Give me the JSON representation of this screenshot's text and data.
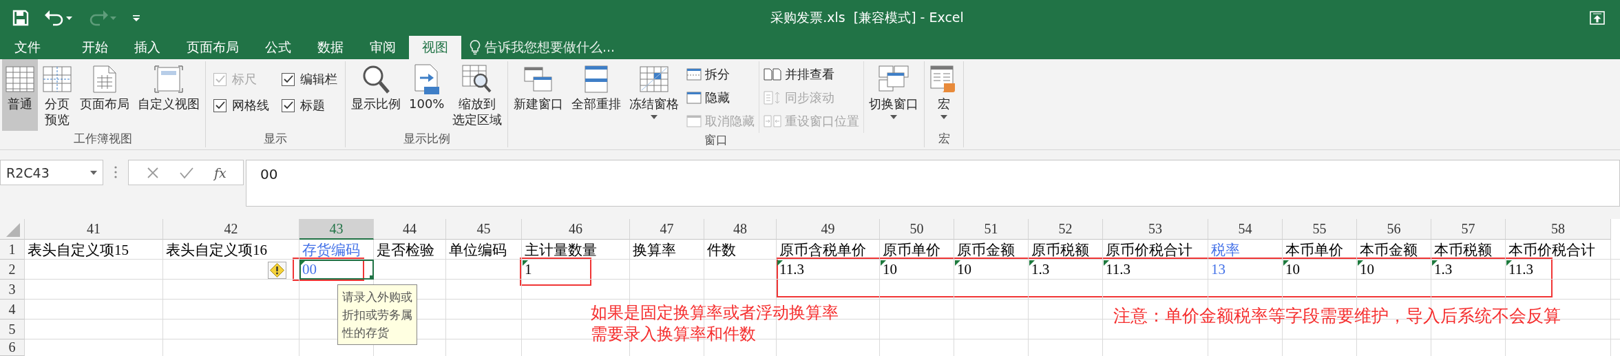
{
  "title_bar": {
    "title": "采购发票.xls  [兼容模式] - Excel",
    "quick_access": [
      {
        "kind": "save",
        "disabled": false
      },
      {
        "kind": "undo",
        "disabled": false
      },
      {
        "kind": "redo",
        "disabled": true
      },
      {
        "kind": "customize",
        "disabled": false
      }
    ]
  },
  "tabs": [
    {
      "label": "文件",
      "selected": false
    },
    {
      "label": "开始",
      "selected": false
    },
    {
      "label": "插入",
      "selected": false
    },
    {
      "label": "页面布局",
      "selected": false
    },
    {
      "label": "公式",
      "selected": false
    },
    {
      "label": "数据",
      "selected": false
    },
    {
      "label": "审阅",
      "selected": false
    },
    {
      "label": "视图",
      "selected": true
    }
  ],
  "tell_me": {
    "placeholder": "告诉我您想要做什么..."
  },
  "ribbon": {
    "groups": [
      {
        "label": "工作簿视图",
        "items": [
          {
            "kind": "large",
            "label": "普通",
            "selected": true
          },
          {
            "kind": "large",
            "label": "分页预览",
            "selected": false
          },
          {
            "kind": "large",
            "label": "页面布局",
            "selected": false
          },
          {
            "kind": "large",
            "label": "自定义视图",
            "selected": false
          }
        ]
      },
      {
        "label": "显示",
        "items": [
          {
            "kind": "check",
            "label": "标尺",
            "checked": true,
            "disabled": true
          },
          {
            "kind": "check",
            "label": "编辑栏",
            "checked": true,
            "disabled": false
          },
          {
            "kind": "check",
            "label": "网格线",
            "checked": true,
            "disabled": false
          },
          {
            "kind": "check",
            "label": "标题",
            "checked": true,
            "disabled": false
          }
        ]
      },
      {
        "label": "显示比例",
        "items": [
          {
            "kind": "large",
            "label": "显示比例"
          },
          {
            "kind": "large",
            "label": "100%"
          },
          {
            "kind": "large",
            "label": "缩放到选定区域"
          }
        ]
      },
      {
        "label": "窗口",
        "items": [
          {
            "kind": "large",
            "label": "新建窗口"
          },
          {
            "kind": "large",
            "label": "全部重排"
          },
          {
            "kind": "large",
            "label": "冻结窗格",
            "dropdown": true
          },
          {
            "kind": "small",
            "label": "拆分",
            "disabled": false
          },
          {
            "kind": "small",
            "label": "隐藏",
            "disabled": false
          },
          {
            "kind": "small",
            "label": "取消隐藏",
            "disabled": true
          },
          {
            "kind": "small",
            "label": "并排查看",
            "disabled": false
          },
          {
            "kind": "small",
            "label": "同步滚动",
            "disabled": true
          },
          {
            "kind": "small",
            "label": "重设窗口位置",
            "disabled": true
          },
          {
            "kind": "large",
            "label": "切换窗口",
            "dropdown": true
          }
        ]
      },
      {
        "label": "宏",
        "items": [
          {
            "kind": "large",
            "label": "宏",
            "dropdown": true
          }
        ]
      }
    ]
  },
  "formula_bar": {
    "name_box": "R2C43",
    "function_button": "fx",
    "formula": "00"
  },
  "sheet": {
    "columns": [
      {
        "label": "41",
        "selected": false
      },
      {
        "label": "42",
        "selected": false
      },
      {
        "label": "43",
        "selected": true
      },
      {
        "label": "44",
        "selected": false
      },
      {
        "label": "45",
        "selected": false
      },
      {
        "label": "46",
        "selected": false
      },
      {
        "label": "47",
        "selected": false
      },
      {
        "label": "48",
        "selected": false
      },
      {
        "label": "49",
        "selected": false
      },
      {
        "label": "50",
        "selected": false
      },
      {
        "label": "51",
        "selected": false
      },
      {
        "label": "52",
        "selected": false
      },
      {
        "label": "53",
        "selected": false
      },
      {
        "label": "54",
        "selected": false
      },
      {
        "label": "55",
        "selected": false
      },
      {
        "label": "56",
        "selected": false
      },
      {
        "label": "57",
        "selected": false
      },
      {
        "label": "58",
        "selected": false
      }
    ],
    "rows": [
      {
        "label": "1",
        "cells": [
          {
            "text": "表头自定义项15",
            "color": "#000000"
          },
          {
            "text": "表头自定义项16",
            "color": "#000000"
          },
          {
            "text": "存货编码",
            "color": "#4472e8"
          },
          {
            "text": "是否检验",
            "color": "#000000"
          },
          {
            "text": "单位编码",
            "color": "#000000"
          },
          {
            "text": "主计量数量",
            "color": "#000000"
          },
          {
            "text": "换算率",
            "color": "#000000"
          },
          {
            "text": "件数",
            "color": "#000000"
          },
          {
            "text": "原币含税单价",
            "color": "#000000"
          },
          {
            "text": "原币单价",
            "color": "#000000"
          },
          {
            "text": "原币金额",
            "color": "#000000"
          },
          {
            "text": "原币税额",
            "color": "#000000"
          },
          {
            "text": "原币价税合计",
            "color": "#000000"
          },
          {
            "text": "税率",
            "color": "#4472e8"
          },
          {
            "text": "本币单价",
            "color": "#000000"
          },
          {
            "text": "本币金额",
            "color": "#000000"
          },
          {
            "text": "本币税额",
            "color": "#000000"
          },
          {
            "text": "本币价税合计",
            "color": "#000000"
          }
        ]
      },
      {
        "label": "2",
        "cells": [
          null,
          null,
          {
            "text": "00",
            "color": "#4472e8",
            "flagged": true,
            "selected": true
          },
          null,
          null,
          {
            "text": "1",
            "color": "#000000",
            "flagged": true,
            "selected": false
          },
          null,
          null,
          {
            "text": "11.3",
            "color": "#000000",
            "flagged": true,
            "selected": false
          },
          {
            "text": "10",
            "color": "#000000",
            "flagged": true,
            "selected": false
          },
          {
            "text": "10",
            "color": "#000000",
            "flagged": true,
            "selected": false
          },
          {
            "text": "1.3",
            "color": "#000000",
            "flagged": true,
            "selected": false
          },
          {
            "text": "11.3",
            "color": "#000000",
            "flagged": true,
            "selected": false
          },
          {
            "text": "13",
            "color": "#4472e8",
            "flagged": false,
            "selected": false
          },
          {
            "text": "10",
            "color": "#000000",
            "flagged": true,
            "selected": false
          },
          {
            "text": "10",
            "color": "#000000",
            "flagged": true,
            "selected": false
          },
          {
            "text": "1.3",
            "color": "#000000",
            "flagged": true,
            "selected": false
          },
          {
            "text": "11.3",
            "color": "#000000",
            "flagged": true,
            "selected": false
          }
        ]
      },
      {
        "label": "3"
      },
      {
        "label": "4"
      },
      {
        "label": "5"
      },
      {
        "label": "6"
      }
    ],
    "tooltip": "请录入外购或折扣或劳务属性的存货",
    "notes": [
      "如果是固定换算率或者浮动换算率需要录入换算率和件数",
      "注意：单价金额税率等字段需要维护，导入后系统不会反算"
    ]
  }
}
